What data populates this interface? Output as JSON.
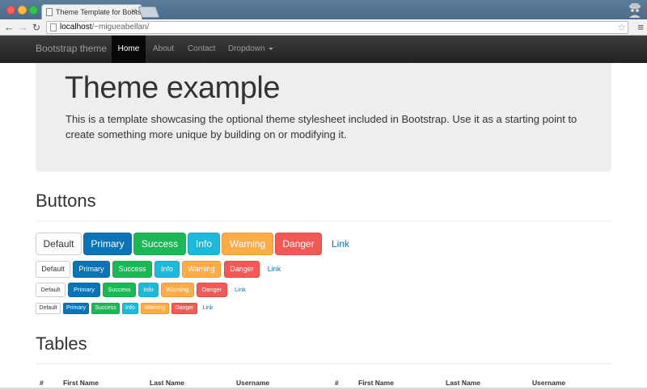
{
  "browser": {
    "tab_title": "Theme Template for Bootst",
    "url_host": "localhost",
    "url_path": "/~migueabellan/"
  },
  "navbar": {
    "brand": "Bootstrap theme",
    "items": [
      {
        "label": "Home"
      },
      {
        "label": "About"
      },
      {
        "label": "Contact"
      },
      {
        "label": "Dropdown"
      }
    ]
  },
  "jumbotron": {
    "title": "Theme example",
    "text": "This is a template showcasing the optional theme stylesheet included in Bootstrap. Use it as a starting point to create something more unique by building on or modifying it."
  },
  "buttons_section": {
    "title": "Buttons",
    "labels": [
      "Default",
      "Primary",
      "Success",
      "Info",
      "Warning",
      "Danger",
      "Link"
    ]
  },
  "tables_section": {
    "title": "Tables",
    "headers": [
      "#",
      "First Name",
      "Last Name",
      "Username"
    ]
  },
  "colors": {
    "primary": "#0b74b7",
    "success": "#1bb856",
    "info": "#1cb9dc",
    "warning": "#feac48",
    "danger": "#f35a55"
  }
}
